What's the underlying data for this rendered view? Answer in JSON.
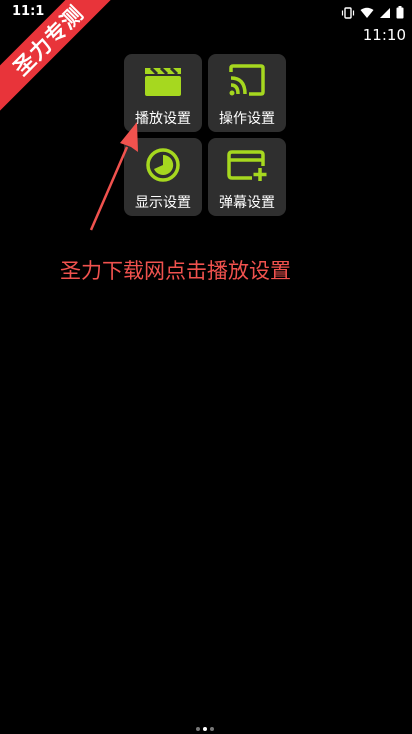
{
  "status_bar": {
    "time": "11:1"
  },
  "clock": {
    "time": "11:10"
  },
  "ribbon": {
    "label": "圣力专测"
  },
  "menu": {
    "items": [
      {
        "label": "播放设置",
        "icon": "clapperboard-icon"
      },
      {
        "label": "操作设置",
        "icon": "cast-icon"
      },
      {
        "label": "显示设置",
        "icon": "pie-clock-icon"
      },
      {
        "label": "弹幕设置",
        "icon": "card-plus-icon"
      }
    ]
  },
  "hint": {
    "text": "圣力下载网点击播放设置"
  },
  "pager": {
    "count": 3,
    "active": 1
  },
  "colors": {
    "accent": "#a6d81f",
    "tile_bg": "#2f2f2f",
    "ribbon": "#e8343a",
    "hint": "#f0524e",
    "background": "#000000"
  }
}
